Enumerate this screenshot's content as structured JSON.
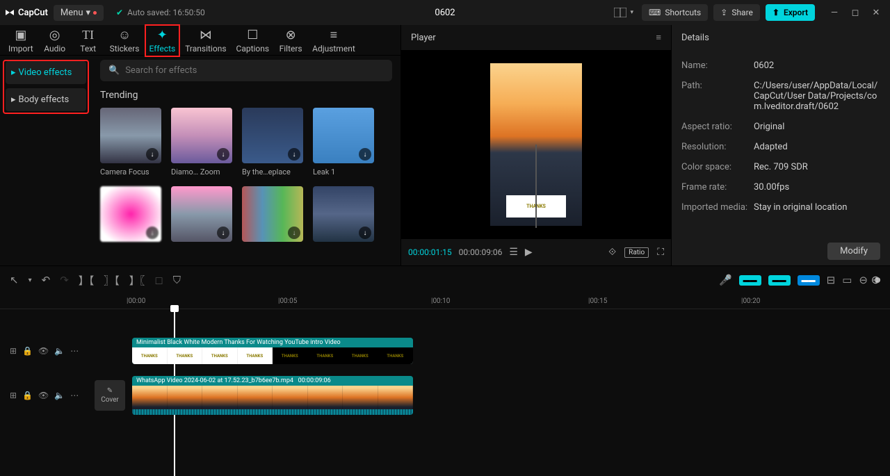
{
  "titlebar": {
    "logo": "CapCut",
    "menu": "Menu",
    "autosave": "Auto saved: 16:50:50",
    "project_title": "0602",
    "shortcuts": "Shortcuts",
    "share": "Share",
    "export": "Export"
  },
  "tool_tabs": [
    {
      "id": "import",
      "label": "Import"
    },
    {
      "id": "audio",
      "label": "Audio"
    },
    {
      "id": "text",
      "label": "Text"
    },
    {
      "id": "stickers",
      "label": "Stickers"
    },
    {
      "id": "effects",
      "label": "Effects"
    },
    {
      "id": "transitions",
      "label": "Transitions"
    },
    {
      "id": "captions",
      "label": "Captions"
    },
    {
      "id": "filters",
      "label": "Filters"
    },
    {
      "id": "adjustment",
      "label": "Adjustment"
    }
  ],
  "effects_sidebar": {
    "video_effects": "Video effects",
    "body_effects": "Body effects"
  },
  "effects_search_placeholder": "Search for effects",
  "effects_section": "Trending",
  "effects": [
    {
      "name": "Camera Focus"
    },
    {
      "name": "Diamo… Zoom"
    },
    {
      "name": "By the…eplace"
    },
    {
      "name": "Leak 1"
    },
    {
      "name": ""
    },
    {
      "name": ""
    },
    {
      "name": ""
    },
    {
      "name": ""
    }
  ],
  "player": {
    "title": "Player",
    "current": "00:00:01:15",
    "total": "00:00:09:06",
    "ratio": "Ratio"
  },
  "details": {
    "title": "Details",
    "labels": {
      "name": "Name:",
      "path": "Path:",
      "aspect": "Aspect ratio:",
      "resolution": "Resolution:",
      "colorspace": "Color space:",
      "framerate": "Frame rate:",
      "imported": "Imported media:"
    },
    "values": {
      "name": "0602",
      "path": "C:/Users/user/AppData/Local/CapCut/User Data/Projects/com.lveditor.draft/0602",
      "aspect": "Original",
      "resolution": "Adapted",
      "colorspace": "Rec. 709 SDR",
      "framerate": "30.00fps",
      "imported": "Stay in original location"
    },
    "modify": "Modify"
  },
  "timeline": {
    "ticks": [
      "|00:00",
      "|00:05",
      "|00:10",
      "|00:15",
      "|00:20"
    ],
    "clip1": "Minimalist Black White Modern Thanks For Watching YouTube intro Video",
    "clip2_name": "WhatsApp Video 2024-06-02 at 17.52.23_b7b6ee7b.mp4",
    "clip2_dur": "00:00:09:06",
    "cover": "Cover"
  }
}
